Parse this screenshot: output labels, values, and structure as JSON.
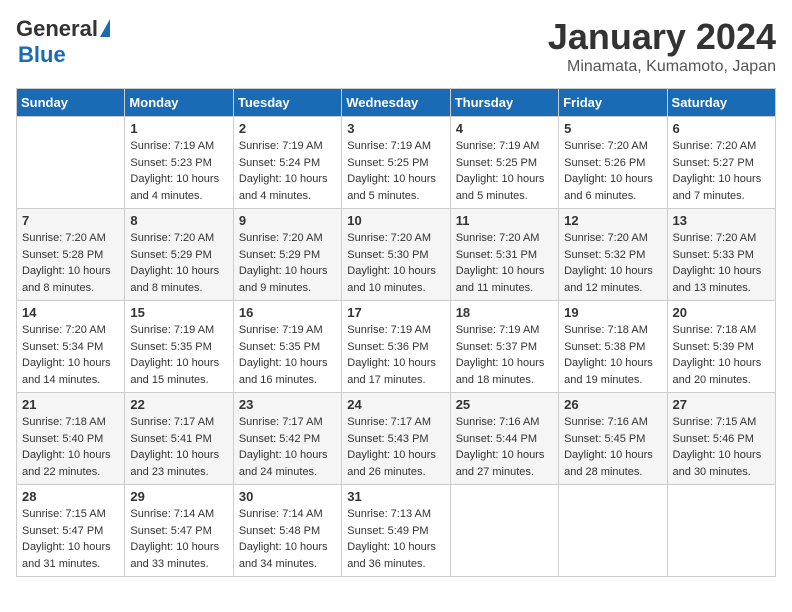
{
  "logo": {
    "general": "General",
    "blue": "Blue"
  },
  "header": {
    "month": "January 2024",
    "location": "Minamata, Kumamoto, Japan"
  },
  "weekdays": [
    "Sunday",
    "Monday",
    "Tuesday",
    "Wednesday",
    "Thursday",
    "Friday",
    "Saturday"
  ],
  "weeks": [
    [
      {
        "day": "",
        "info": ""
      },
      {
        "day": "1",
        "info": "Sunrise: 7:19 AM\nSunset: 5:23 PM\nDaylight: 10 hours\nand 4 minutes."
      },
      {
        "day": "2",
        "info": "Sunrise: 7:19 AM\nSunset: 5:24 PM\nDaylight: 10 hours\nand 4 minutes."
      },
      {
        "day": "3",
        "info": "Sunrise: 7:19 AM\nSunset: 5:25 PM\nDaylight: 10 hours\nand 5 minutes."
      },
      {
        "day": "4",
        "info": "Sunrise: 7:19 AM\nSunset: 5:25 PM\nDaylight: 10 hours\nand 5 minutes."
      },
      {
        "day": "5",
        "info": "Sunrise: 7:20 AM\nSunset: 5:26 PM\nDaylight: 10 hours\nand 6 minutes."
      },
      {
        "day": "6",
        "info": "Sunrise: 7:20 AM\nSunset: 5:27 PM\nDaylight: 10 hours\nand 7 minutes."
      }
    ],
    [
      {
        "day": "7",
        "info": "Sunrise: 7:20 AM\nSunset: 5:28 PM\nDaylight: 10 hours\nand 8 minutes."
      },
      {
        "day": "8",
        "info": "Sunrise: 7:20 AM\nSunset: 5:29 PM\nDaylight: 10 hours\nand 8 minutes."
      },
      {
        "day": "9",
        "info": "Sunrise: 7:20 AM\nSunset: 5:29 PM\nDaylight: 10 hours\nand 9 minutes."
      },
      {
        "day": "10",
        "info": "Sunrise: 7:20 AM\nSunset: 5:30 PM\nDaylight: 10 hours\nand 10 minutes."
      },
      {
        "day": "11",
        "info": "Sunrise: 7:20 AM\nSunset: 5:31 PM\nDaylight: 10 hours\nand 11 minutes."
      },
      {
        "day": "12",
        "info": "Sunrise: 7:20 AM\nSunset: 5:32 PM\nDaylight: 10 hours\nand 12 minutes."
      },
      {
        "day": "13",
        "info": "Sunrise: 7:20 AM\nSunset: 5:33 PM\nDaylight: 10 hours\nand 13 minutes."
      }
    ],
    [
      {
        "day": "14",
        "info": "Sunrise: 7:20 AM\nSunset: 5:34 PM\nDaylight: 10 hours\nand 14 minutes."
      },
      {
        "day": "15",
        "info": "Sunrise: 7:19 AM\nSunset: 5:35 PM\nDaylight: 10 hours\nand 15 minutes."
      },
      {
        "day": "16",
        "info": "Sunrise: 7:19 AM\nSunset: 5:35 PM\nDaylight: 10 hours\nand 16 minutes."
      },
      {
        "day": "17",
        "info": "Sunrise: 7:19 AM\nSunset: 5:36 PM\nDaylight: 10 hours\nand 17 minutes."
      },
      {
        "day": "18",
        "info": "Sunrise: 7:19 AM\nSunset: 5:37 PM\nDaylight: 10 hours\nand 18 minutes."
      },
      {
        "day": "19",
        "info": "Sunrise: 7:18 AM\nSunset: 5:38 PM\nDaylight: 10 hours\nand 19 minutes."
      },
      {
        "day": "20",
        "info": "Sunrise: 7:18 AM\nSunset: 5:39 PM\nDaylight: 10 hours\nand 20 minutes."
      }
    ],
    [
      {
        "day": "21",
        "info": "Sunrise: 7:18 AM\nSunset: 5:40 PM\nDaylight: 10 hours\nand 22 minutes."
      },
      {
        "day": "22",
        "info": "Sunrise: 7:17 AM\nSunset: 5:41 PM\nDaylight: 10 hours\nand 23 minutes."
      },
      {
        "day": "23",
        "info": "Sunrise: 7:17 AM\nSunset: 5:42 PM\nDaylight: 10 hours\nand 24 minutes."
      },
      {
        "day": "24",
        "info": "Sunrise: 7:17 AM\nSunset: 5:43 PM\nDaylight: 10 hours\nand 26 minutes."
      },
      {
        "day": "25",
        "info": "Sunrise: 7:16 AM\nSunset: 5:44 PM\nDaylight: 10 hours\nand 27 minutes."
      },
      {
        "day": "26",
        "info": "Sunrise: 7:16 AM\nSunset: 5:45 PM\nDaylight: 10 hours\nand 28 minutes."
      },
      {
        "day": "27",
        "info": "Sunrise: 7:15 AM\nSunset: 5:46 PM\nDaylight: 10 hours\nand 30 minutes."
      }
    ],
    [
      {
        "day": "28",
        "info": "Sunrise: 7:15 AM\nSunset: 5:47 PM\nDaylight: 10 hours\nand 31 minutes."
      },
      {
        "day": "29",
        "info": "Sunrise: 7:14 AM\nSunset: 5:47 PM\nDaylight: 10 hours\nand 33 minutes."
      },
      {
        "day": "30",
        "info": "Sunrise: 7:14 AM\nSunset: 5:48 PM\nDaylight: 10 hours\nand 34 minutes."
      },
      {
        "day": "31",
        "info": "Sunrise: 7:13 AM\nSunset: 5:49 PM\nDaylight: 10 hours\nand 36 minutes."
      },
      {
        "day": "",
        "info": ""
      },
      {
        "day": "",
        "info": ""
      },
      {
        "day": "",
        "info": ""
      }
    ]
  ]
}
